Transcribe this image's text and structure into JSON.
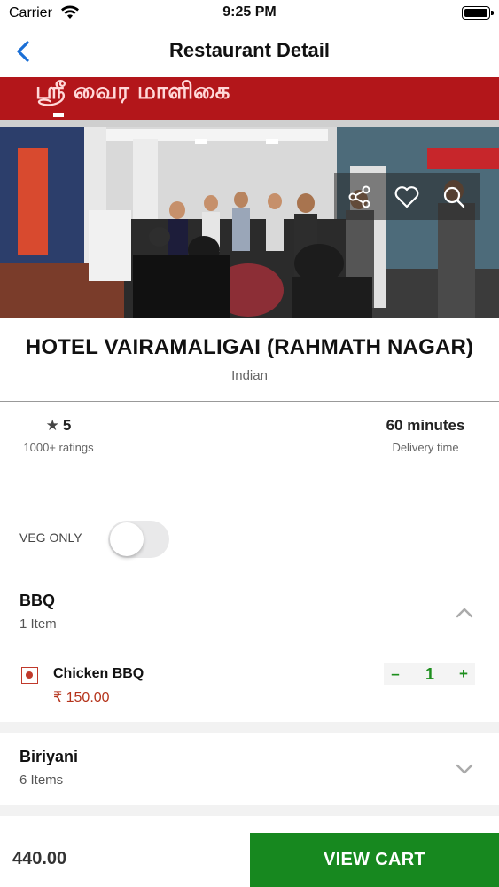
{
  "status_bar": {
    "carrier": "Carrier",
    "time": "9:25 PM"
  },
  "nav": {
    "title": "Restaurant Detail",
    "back_icon": "chevron-left-icon"
  },
  "hero": {
    "sign_text": "ஸ்ரீ வைர மாளிகை",
    "actions": [
      "share-icon",
      "heart-icon",
      "search-icon"
    ]
  },
  "restaurant": {
    "name": "HOTEL VAIRAMALIGAI (RAHMATH NAGAR)",
    "cuisine": "Indian"
  },
  "stats": {
    "rating": "5",
    "rating_label": "1000+ ratings",
    "delivery_time": "60 minutes",
    "delivery_label": "Delivery time"
  },
  "veg_filter": {
    "label": "VEG ONLY",
    "enabled": false
  },
  "categories": [
    {
      "name": "BBQ",
      "count": "1 Item",
      "expanded": true,
      "items": [
        {
          "name": "Chicken BBQ",
          "price": "₹  150.00",
          "quantity": "1",
          "minus": "–",
          "plus": "+",
          "type": "non-veg"
        }
      ]
    },
    {
      "name": "Biriyani",
      "count": "6 Items",
      "expanded": false
    }
  ],
  "cart": {
    "total": "440.00",
    "button_label": "VIEW CART"
  },
  "colors": {
    "accent": "#17881f",
    "price": "#b5341c",
    "link": "#1a6fd6"
  }
}
